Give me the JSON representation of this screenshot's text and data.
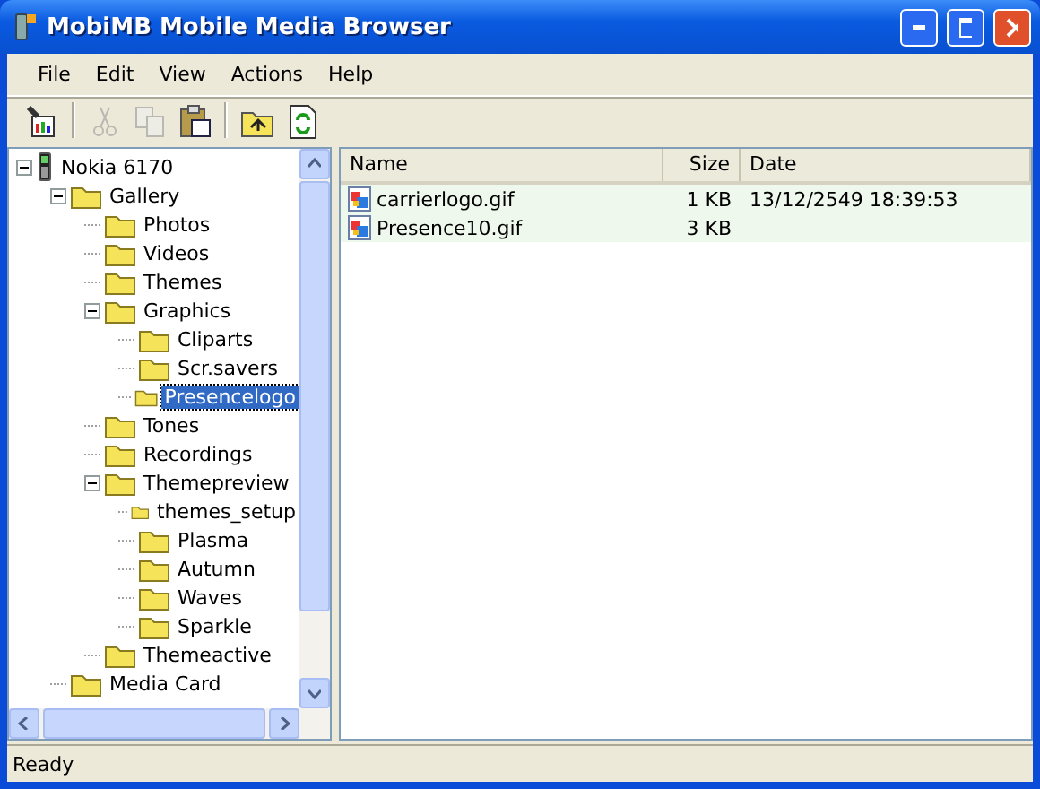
{
  "window": {
    "title": "MobiMB Mobile Media Browser"
  },
  "menu": [
    "File",
    "Edit",
    "View",
    "Actions",
    "Help"
  ],
  "toolbar": [
    {
      "kind": "properties",
      "disabled": false
    },
    {
      "kind": "separator"
    },
    {
      "kind": "cut",
      "disabled": true
    },
    {
      "kind": "copy",
      "disabled": true
    },
    {
      "kind": "paste",
      "disabled": false
    },
    {
      "kind": "separator"
    },
    {
      "kind": "up",
      "disabled": false
    },
    {
      "kind": "refresh",
      "disabled": false
    }
  ],
  "tree": [
    {
      "label": "Nokia 6170",
      "kind": "phone",
      "expanded": true,
      "selected": false,
      "children": [
        {
          "label": "Gallery",
          "kind": "folder",
          "expanded": true,
          "selected": false,
          "children": [
            {
              "label": "Photos",
              "kind": "folder",
              "selected": false
            },
            {
              "label": "Videos",
              "kind": "folder",
              "selected": false
            },
            {
              "label": "Themes",
              "kind": "folder",
              "selected": false
            },
            {
              "label": "Graphics",
              "kind": "folder",
              "expanded": true,
              "selected": false,
              "children": [
                {
                  "label": "Cliparts",
                  "kind": "folder",
                  "selected": false
                },
                {
                  "label": "Scr.savers",
                  "kind": "folder",
                  "selected": false
                },
                {
                  "label": "Presencelogo",
                  "kind": "folder",
                  "selected": true
                }
              ]
            },
            {
              "label": "Tones",
              "kind": "folder",
              "selected": false
            },
            {
              "label": "Recordings",
              "kind": "folder",
              "selected": false
            },
            {
              "label": "Themepreview",
              "kind": "folder",
              "expanded": true,
              "selected": false,
              "children": [
                {
                  "label": "themes_setup",
                  "kind": "folder",
                  "selected": false
                },
                {
                  "label": "Plasma",
                  "kind": "folder",
                  "selected": false
                },
                {
                  "label": "Autumn",
                  "kind": "folder",
                  "selected": false
                },
                {
                  "label": "Waves",
                  "kind": "folder",
                  "selected": false
                },
                {
                  "label": "Sparkle",
                  "kind": "folder",
                  "selected": false
                }
              ]
            },
            {
              "label": "Themeactive",
              "kind": "folder",
              "selected": false
            }
          ]
        },
        {
          "label": "Media Card",
          "kind": "folder",
          "selected": false
        }
      ]
    }
  ],
  "files": {
    "columns": [
      "Name",
      "Size",
      "Date"
    ],
    "rows": [
      {
        "name": "carrierlogo.gif",
        "size": "1 KB",
        "date": "13/12/2549 18:39:53"
      },
      {
        "name": "Presence10.gif",
        "size": "3 KB"
      }
    ]
  },
  "status_bar": "Ready"
}
